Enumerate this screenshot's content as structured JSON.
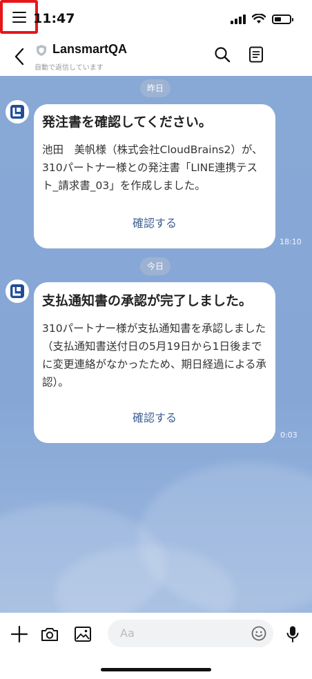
{
  "status_bar": {
    "time": "11:47"
  },
  "header": {
    "title": "LansmartQA",
    "subtitle": "自動で返信しています",
    "icons": [
      "back-icon",
      "shield-icon",
      "search-icon",
      "notes-icon",
      "menu-icon"
    ],
    "highlight_color": "#e5161b"
  },
  "messages": [
    {
      "date_label": "昨日",
      "title": "発注書を確認してください。",
      "body": "池田　美帆様（株式会社CloudBrains2）が、310パートナー様との発注書「LINE連携テスト_請求書_03」を作成しました。",
      "action": "確認する",
      "time": "18:10"
    },
    {
      "date_label": "今日",
      "title": "支払通知書の承認が完了しました。",
      "body": "310パートナー様が支払通知書を承認しました（支払通知書送付日の5月19日から1日後までに変更連絡がなかったため、期日経過による承認）。",
      "action": "確認する",
      "time": "0:03"
    }
  ],
  "input": {
    "placeholder": "Aa",
    "icons": [
      "plus-icon",
      "camera-icon",
      "image-icon",
      "emoji-icon",
      "mic-icon"
    ]
  },
  "colors": {
    "chat_background": "#8aa9d6",
    "link": "#3d5f92"
  }
}
